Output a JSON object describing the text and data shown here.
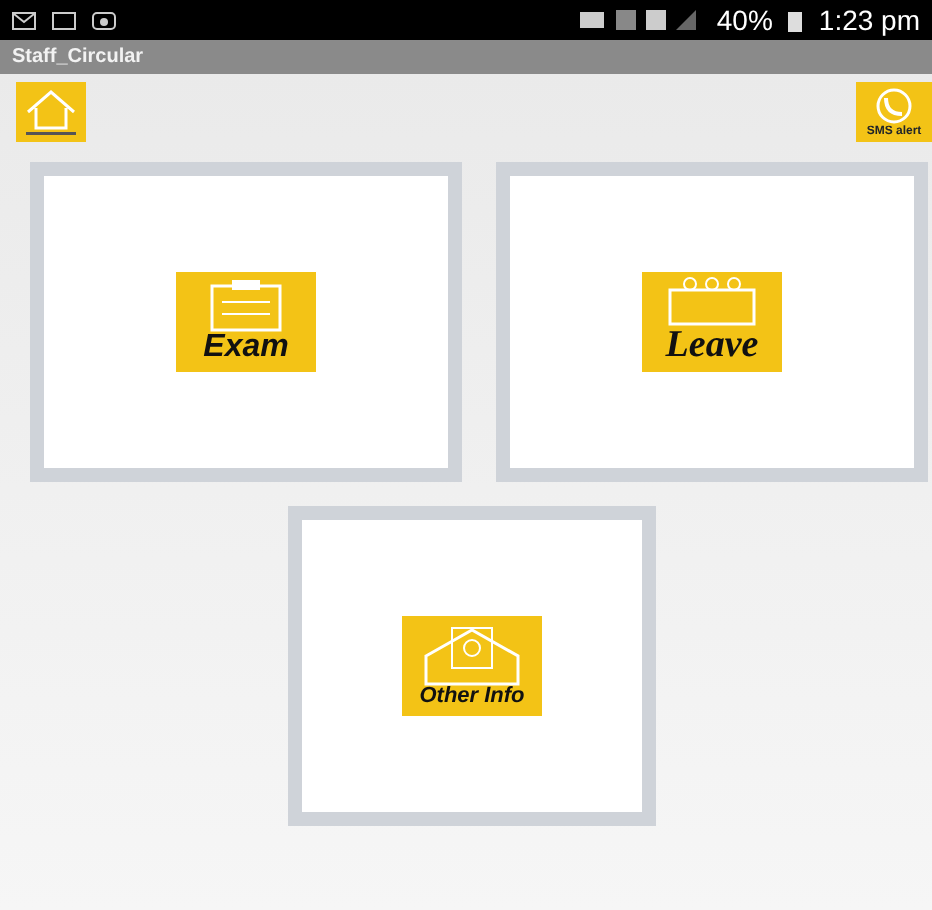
{
  "status_bar": {
    "battery": "40%",
    "time": "1:23 pm"
  },
  "window": {
    "title": "Staff_Circular"
  },
  "toolbar": {
    "sms_label": "SMS alert"
  },
  "tiles": [
    {
      "label": "Exam",
      "kind": "exam"
    },
    {
      "label": "Leave",
      "kind": "leave"
    },
    {
      "label": "Other Info",
      "kind": "info"
    }
  ]
}
